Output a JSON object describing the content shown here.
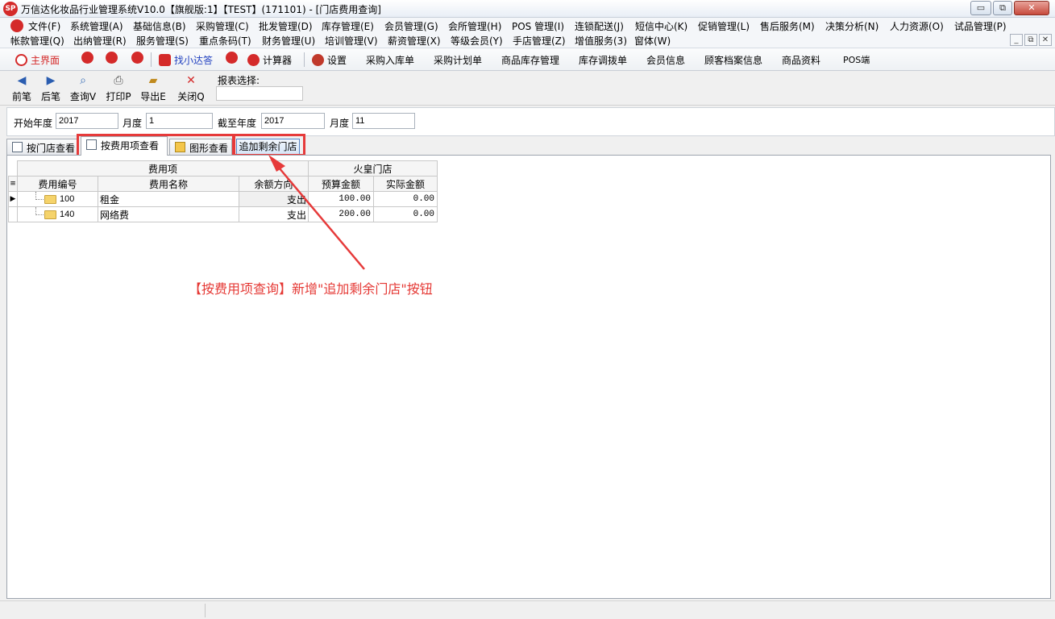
{
  "window": {
    "title": "万信达化妆品行业管理系统V10.0【旗舰版:1】【TEST】(171101) - [门店费用查询]",
    "app_icon": "SP",
    "minimize": "▭",
    "restore": "⧉",
    "close": "✕"
  },
  "menu": {
    "row1": [
      "文件(F)",
      "系统管理(A)",
      "基础信息(B)",
      "采购管理(C)",
      "批发管理(D)",
      "库存管理(E)",
      "会员管理(G)",
      "会所管理(H)",
      "POS 管理(I)",
      "连锁配送(J)",
      "短信中心(K)",
      "促销管理(L)",
      "售后服务(M)",
      "决策分析(N)",
      "人力资源(O)",
      "试品管理(P)"
    ],
    "row2": [
      "帐款管理(Q)",
      "出纳管理(R)",
      "服务管理(S)",
      "重点条码(T)",
      "财务管理(U)",
      "培训管理(V)",
      "薪资管理(X)",
      "等级会员(Y)",
      "手店管理(Z)",
      "增值服务(3)",
      "窗体(W)"
    ],
    "mdi_min": "_",
    "mdi_restore": "⧉",
    "mdi_close": "✕"
  },
  "toolbar": {
    "home": "主界面",
    "find": "找小达答",
    "calc": "计算器",
    "settings": "设置",
    "links": [
      "采购入库单",
      "采购计划单",
      "商品库存管理",
      "库存调拨单",
      "会员信息",
      "顾客档案信息",
      "商品资料",
      "POS端"
    ]
  },
  "actions": {
    "prev": "前笔",
    "next": "后笔",
    "query": "查询V",
    "print": "打印P",
    "export": "导出E",
    "close": "关闭Q",
    "report_label": "报表选择:"
  },
  "filters": {
    "start_year_label": "开始年度",
    "start_year": "2017",
    "start_month_label": "月度",
    "start_month": "1",
    "end_year_label": "截至年度",
    "end_year": "2017",
    "end_month_label": "月度",
    "end_month": "11"
  },
  "tabs": {
    "by_store": "按门店查看",
    "by_fee": "按费用项查看",
    "chart": "图形查看",
    "add_store": "追加剩余门店"
  },
  "grid": {
    "group_fee": "费用项",
    "group_store": "火皇门店",
    "col_code": "费用编号",
    "col_name": "费用名称",
    "col_dir": "余额方向",
    "col_budget": "预算金额",
    "col_actual": "实际金额",
    "row_marker": "▶",
    "header_marker": "≡",
    "rows": [
      {
        "code": "100",
        "name": "租金",
        "dir": "支出",
        "budget": "100.00",
        "actual": "0.00"
      },
      {
        "code": "140",
        "name": "网络费",
        "dir": "支出",
        "budget": "200.00",
        "actual": "0.00"
      }
    ]
  },
  "annotation": {
    "text": "【按费用项查询】新增\"追加剩余门店\"按钮",
    "color": "#e53935"
  },
  "colors": {
    "accent_red": "#e63a3a",
    "brand_red": "#d42a2a"
  }
}
